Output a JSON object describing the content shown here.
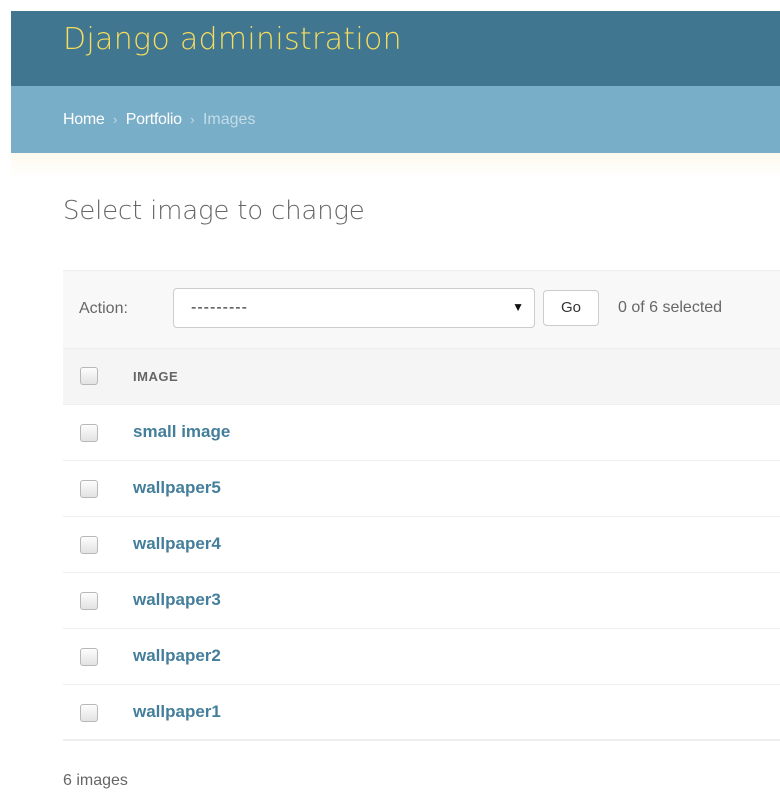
{
  "header": {
    "title": "Django administration"
  },
  "breadcrumbs": {
    "home": "Home",
    "app": "Portfolio",
    "current": "Images",
    "separator": "›"
  },
  "page": {
    "title": "Select image to change"
  },
  "actions": {
    "label": "Action:",
    "selected_option": "---------",
    "go_label": "Go",
    "counter": "0 of 6 selected"
  },
  "table": {
    "column": "IMAGE",
    "rows": [
      "small image",
      "wallpaper5",
      "wallpaper4",
      "wallpaper3",
      "wallpaper2",
      "wallpaper1"
    ]
  },
  "paginator": {
    "count_text": "6 images"
  },
  "colors": {
    "header_bg": "#417690",
    "title": "#f5dd5d",
    "breadcrumbs_bg": "#79aec8",
    "link": "#447e9b"
  }
}
